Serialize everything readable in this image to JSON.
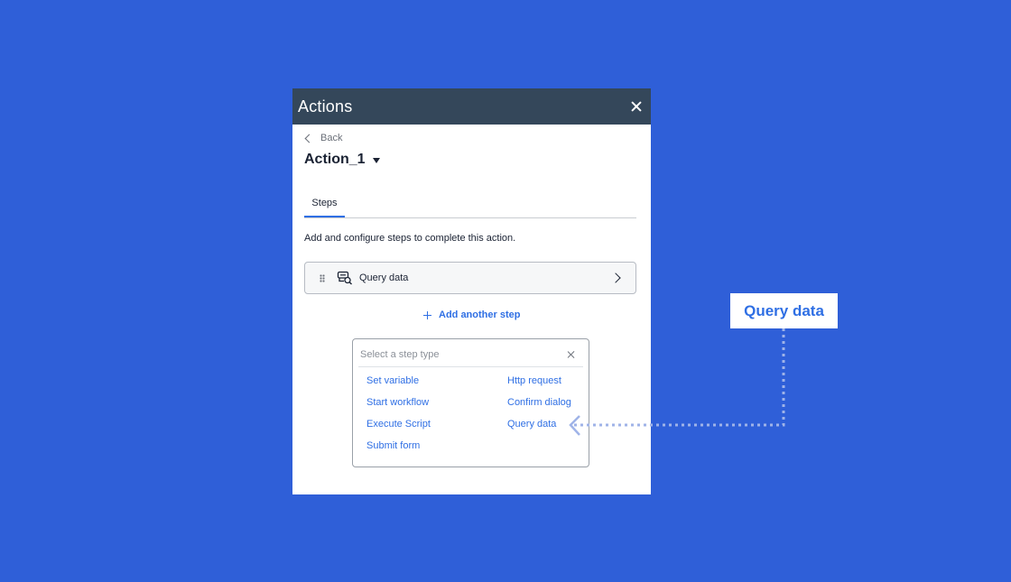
{
  "panel": {
    "title": "Actions",
    "back_label": "Back",
    "action_name": "Action_1",
    "tabs": [
      {
        "label": "Steps",
        "active": true
      }
    ],
    "description": "Add and configure steps to complete this action.",
    "steps": [
      {
        "label": "Query data",
        "icon": "query-data-icon"
      }
    ],
    "add_step_label": "Add another step"
  },
  "step_picker": {
    "placeholder": "Select a step type",
    "options_left": [
      "Set variable",
      "Start workflow",
      "Execute Script",
      "Submit form"
    ],
    "options_right": [
      "Http request",
      "Confirm dialog",
      "Query data"
    ]
  },
  "callout": {
    "label": "Query data"
  },
  "colors": {
    "background": "#2f5fd8",
    "header": "#34475a",
    "accent": "#2f6fe4",
    "connector": "#9fb3e8"
  }
}
